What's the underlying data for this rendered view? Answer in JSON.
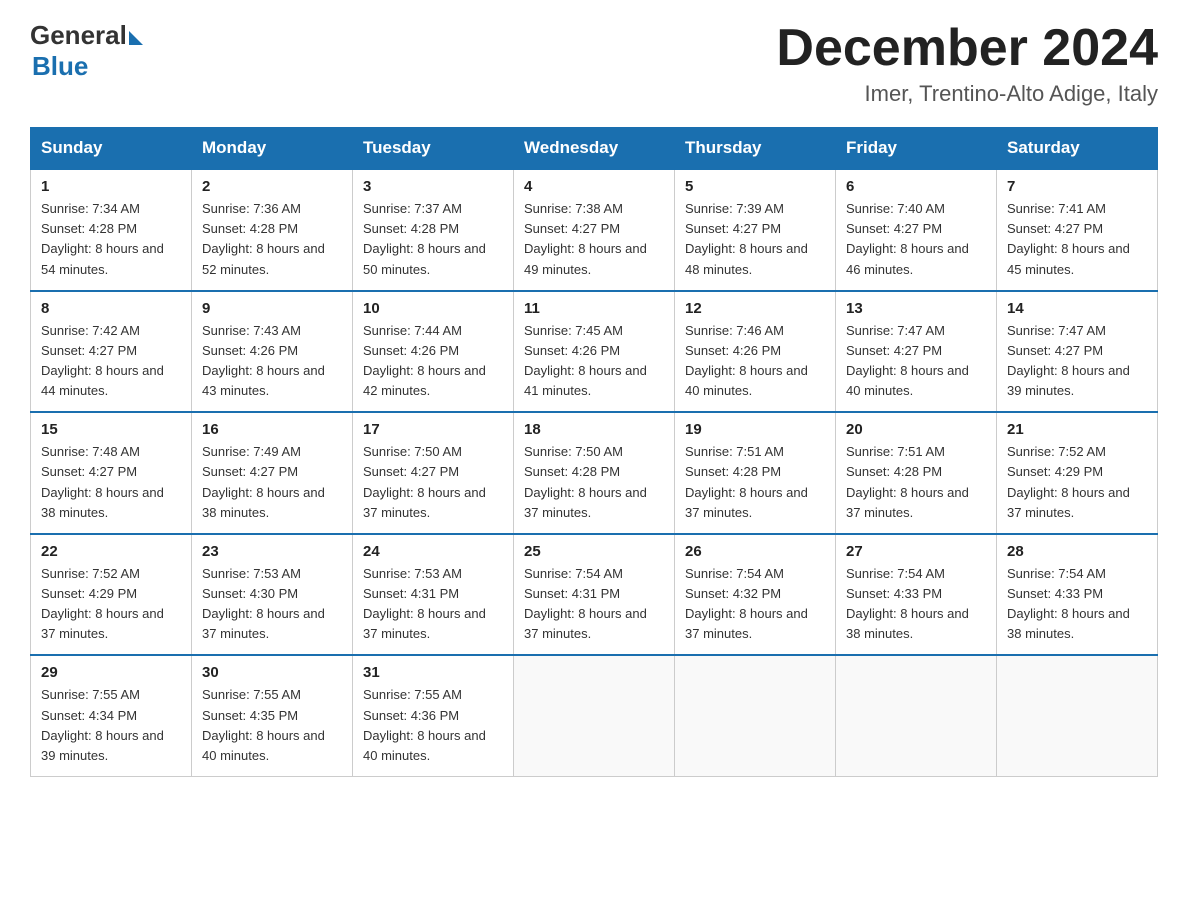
{
  "header": {
    "logo_general": "General",
    "logo_blue": "Blue",
    "month_title": "December 2024",
    "location": "Imer, Trentino-Alto Adige, Italy"
  },
  "days_of_week": [
    "Sunday",
    "Monday",
    "Tuesday",
    "Wednesday",
    "Thursday",
    "Friday",
    "Saturday"
  ],
  "weeks": [
    [
      {
        "day": "1",
        "sunrise": "7:34 AM",
        "sunset": "4:28 PM",
        "daylight": "8 hours and 54 minutes."
      },
      {
        "day": "2",
        "sunrise": "7:36 AM",
        "sunset": "4:28 PM",
        "daylight": "8 hours and 52 minutes."
      },
      {
        "day": "3",
        "sunrise": "7:37 AM",
        "sunset": "4:28 PM",
        "daylight": "8 hours and 50 minutes."
      },
      {
        "day": "4",
        "sunrise": "7:38 AM",
        "sunset": "4:27 PM",
        "daylight": "8 hours and 49 minutes."
      },
      {
        "day": "5",
        "sunrise": "7:39 AM",
        "sunset": "4:27 PM",
        "daylight": "8 hours and 48 minutes."
      },
      {
        "day": "6",
        "sunrise": "7:40 AM",
        "sunset": "4:27 PM",
        "daylight": "8 hours and 46 minutes."
      },
      {
        "day": "7",
        "sunrise": "7:41 AM",
        "sunset": "4:27 PM",
        "daylight": "8 hours and 45 minutes."
      }
    ],
    [
      {
        "day": "8",
        "sunrise": "7:42 AM",
        "sunset": "4:27 PM",
        "daylight": "8 hours and 44 minutes."
      },
      {
        "day": "9",
        "sunrise": "7:43 AM",
        "sunset": "4:26 PM",
        "daylight": "8 hours and 43 minutes."
      },
      {
        "day": "10",
        "sunrise": "7:44 AM",
        "sunset": "4:26 PM",
        "daylight": "8 hours and 42 minutes."
      },
      {
        "day": "11",
        "sunrise": "7:45 AM",
        "sunset": "4:26 PM",
        "daylight": "8 hours and 41 minutes."
      },
      {
        "day": "12",
        "sunrise": "7:46 AM",
        "sunset": "4:26 PM",
        "daylight": "8 hours and 40 minutes."
      },
      {
        "day": "13",
        "sunrise": "7:47 AM",
        "sunset": "4:27 PM",
        "daylight": "8 hours and 40 minutes."
      },
      {
        "day": "14",
        "sunrise": "7:47 AM",
        "sunset": "4:27 PM",
        "daylight": "8 hours and 39 minutes."
      }
    ],
    [
      {
        "day": "15",
        "sunrise": "7:48 AM",
        "sunset": "4:27 PM",
        "daylight": "8 hours and 38 minutes."
      },
      {
        "day": "16",
        "sunrise": "7:49 AM",
        "sunset": "4:27 PM",
        "daylight": "8 hours and 38 minutes."
      },
      {
        "day": "17",
        "sunrise": "7:50 AM",
        "sunset": "4:27 PM",
        "daylight": "8 hours and 37 minutes."
      },
      {
        "day": "18",
        "sunrise": "7:50 AM",
        "sunset": "4:28 PM",
        "daylight": "8 hours and 37 minutes."
      },
      {
        "day": "19",
        "sunrise": "7:51 AM",
        "sunset": "4:28 PM",
        "daylight": "8 hours and 37 minutes."
      },
      {
        "day": "20",
        "sunrise": "7:51 AM",
        "sunset": "4:28 PM",
        "daylight": "8 hours and 37 minutes."
      },
      {
        "day": "21",
        "sunrise": "7:52 AM",
        "sunset": "4:29 PM",
        "daylight": "8 hours and 37 minutes."
      }
    ],
    [
      {
        "day": "22",
        "sunrise": "7:52 AM",
        "sunset": "4:29 PM",
        "daylight": "8 hours and 37 minutes."
      },
      {
        "day": "23",
        "sunrise": "7:53 AM",
        "sunset": "4:30 PM",
        "daylight": "8 hours and 37 minutes."
      },
      {
        "day": "24",
        "sunrise": "7:53 AM",
        "sunset": "4:31 PM",
        "daylight": "8 hours and 37 minutes."
      },
      {
        "day": "25",
        "sunrise": "7:54 AM",
        "sunset": "4:31 PM",
        "daylight": "8 hours and 37 minutes."
      },
      {
        "day": "26",
        "sunrise": "7:54 AM",
        "sunset": "4:32 PM",
        "daylight": "8 hours and 37 minutes."
      },
      {
        "day": "27",
        "sunrise": "7:54 AM",
        "sunset": "4:33 PM",
        "daylight": "8 hours and 38 minutes."
      },
      {
        "day": "28",
        "sunrise": "7:54 AM",
        "sunset": "4:33 PM",
        "daylight": "8 hours and 38 minutes."
      }
    ],
    [
      {
        "day": "29",
        "sunrise": "7:55 AM",
        "sunset": "4:34 PM",
        "daylight": "8 hours and 39 minutes."
      },
      {
        "day": "30",
        "sunrise": "7:55 AM",
        "sunset": "4:35 PM",
        "daylight": "8 hours and 40 minutes."
      },
      {
        "day": "31",
        "sunrise": "7:55 AM",
        "sunset": "4:36 PM",
        "daylight": "8 hours and 40 minutes."
      },
      null,
      null,
      null,
      null
    ]
  ]
}
